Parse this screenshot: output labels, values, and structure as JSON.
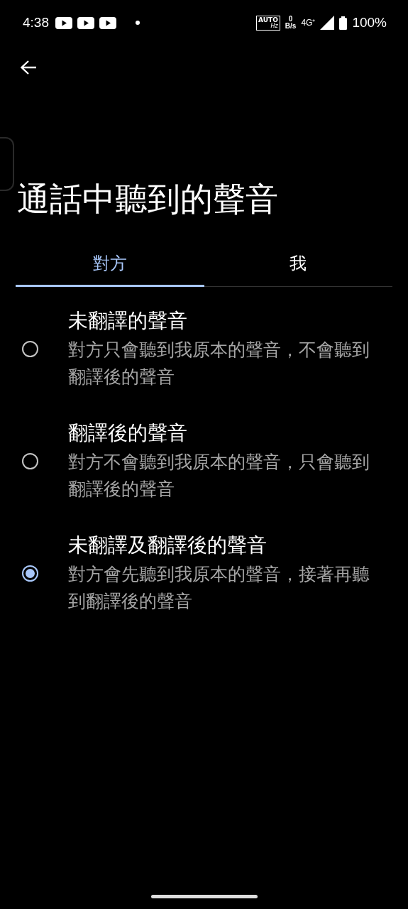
{
  "status_bar": {
    "time": "4:38",
    "notifications": [
      {
        "kind": "video"
      },
      {
        "kind": "video"
      },
      {
        "kind": "video"
      }
    ],
    "refresh_badge": {
      "top": "AUTO",
      "bottom": "Hz"
    },
    "data_rate": {
      "value": "0",
      "unit": "B/s"
    },
    "network": "4G⁺",
    "battery": "100%"
  },
  "title": "通話中聽到的聲音",
  "tabs": [
    {
      "label": "對方",
      "selected": true
    },
    {
      "label": "我",
      "selected": false
    }
  ],
  "options": [
    {
      "title": "未翻譯的聲音",
      "description": "對方只會聽到我原本的聲音，不會聽到翻譯後的聲音",
      "selected": false
    },
    {
      "title": "翻譯後的聲音",
      "description": "對方不會聽到我原本的聲音，只會聽到翻譯後的聲音",
      "selected": false
    },
    {
      "title": "未翻譯及翻譯後的聲音",
      "description": "對方會先聽到我原本的聲音，接著再聽到翻譯後的聲音",
      "selected": true
    }
  ]
}
